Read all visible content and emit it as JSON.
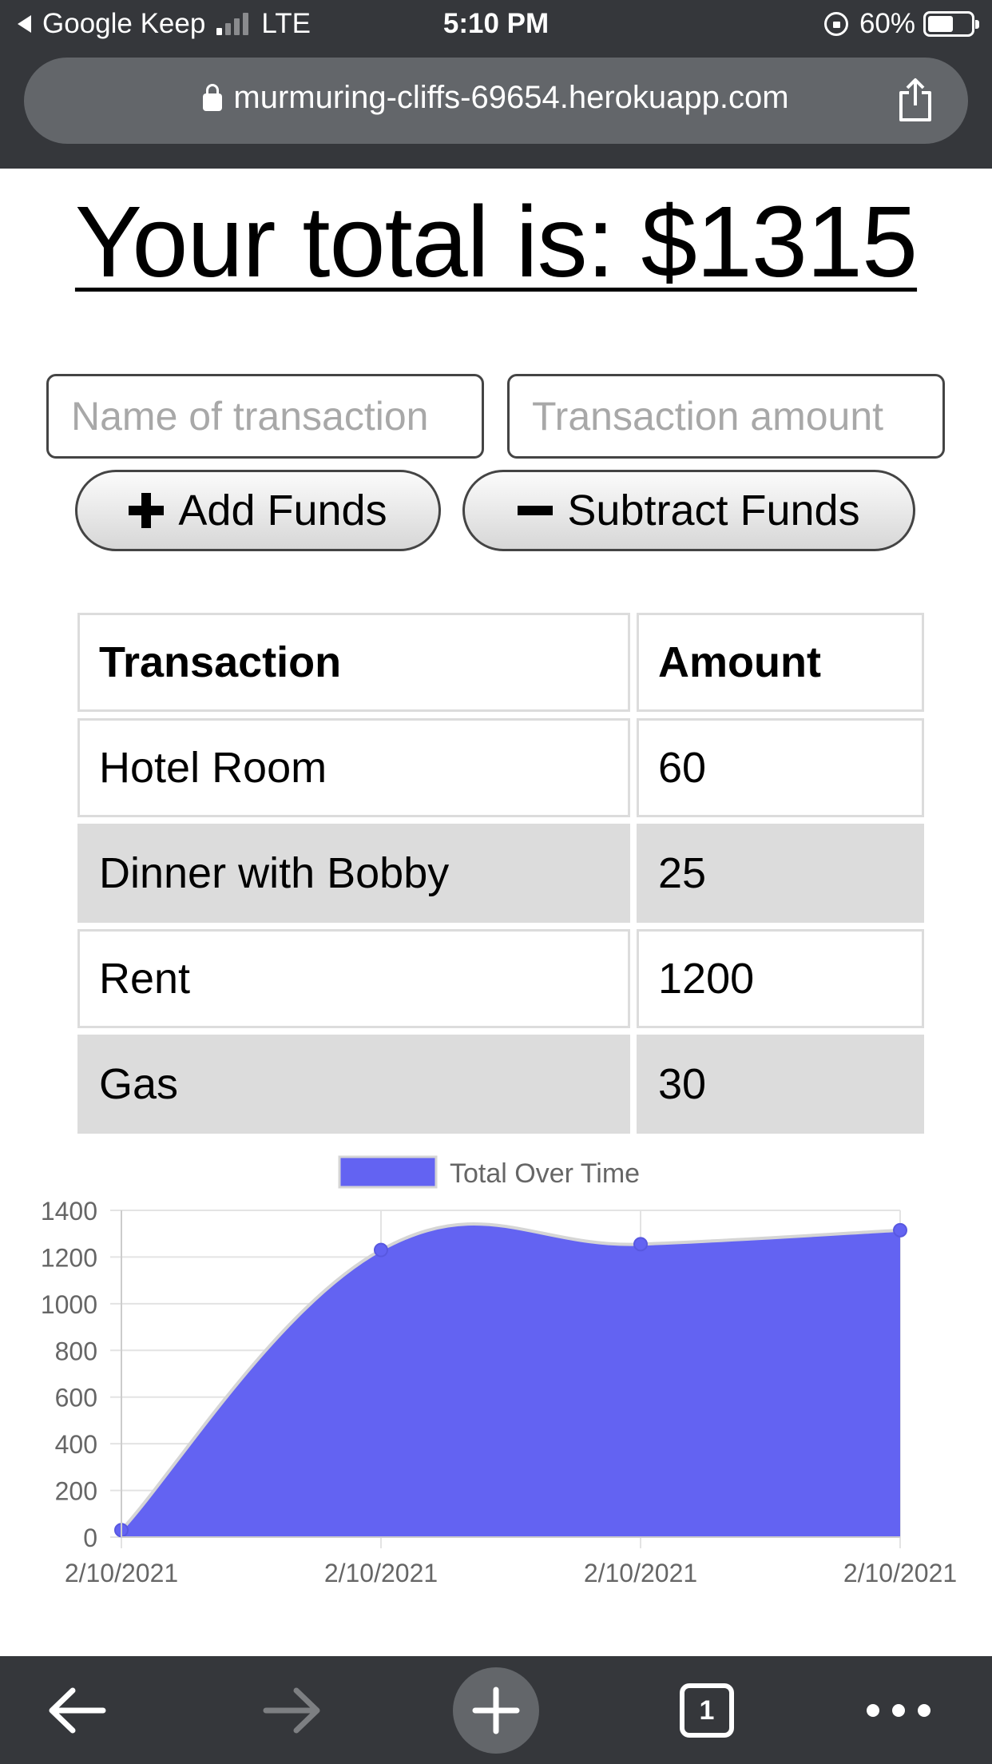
{
  "status_bar": {
    "back_app": "Google Keep",
    "network": "LTE",
    "time": "5:10 PM",
    "battery": "60%",
    "battery_level": 0.6
  },
  "browser": {
    "url": "murmuring-cliffs-69654.herokuapp.com",
    "tab_count": "1"
  },
  "page": {
    "total_heading": "Your total is: $1315",
    "name_placeholder": "Name of transaction",
    "amount_placeholder": "Transaction amount",
    "add_label": "Add Funds",
    "subtract_label": "Subtract Funds"
  },
  "table": {
    "headers": [
      "Transaction",
      "Amount"
    ],
    "rows": [
      {
        "name": "Hotel Room",
        "amount": "60"
      },
      {
        "name": "Dinner with Bobby",
        "amount": "25"
      },
      {
        "name": "Rent",
        "amount": "1200"
      },
      {
        "name": "Gas",
        "amount": "30"
      }
    ]
  },
  "chart_data": {
    "type": "area",
    "legend": "Total Over Time",
    "legend_position": "top",
    "x": [
      "2/10/2021",
      "2/10/2021",
      "2/10/2021",
      "2/10/2021"
    ],
    "series": [
      {
        "name": "Total Over Time",
        "values": [
          30,
          1230,
          1255,
          1315
        ]
      }
    ],
    "ylim": [
      0,
      1400
    ],
    "yticks": [
      0,
      200,
      400,
      600,
      800,
      1000,
      1200,
      1400
    ],
    "grid": true,
    "fill_color": "#6363f2",
    "line_color": "#d5d5d5"
  }
}
